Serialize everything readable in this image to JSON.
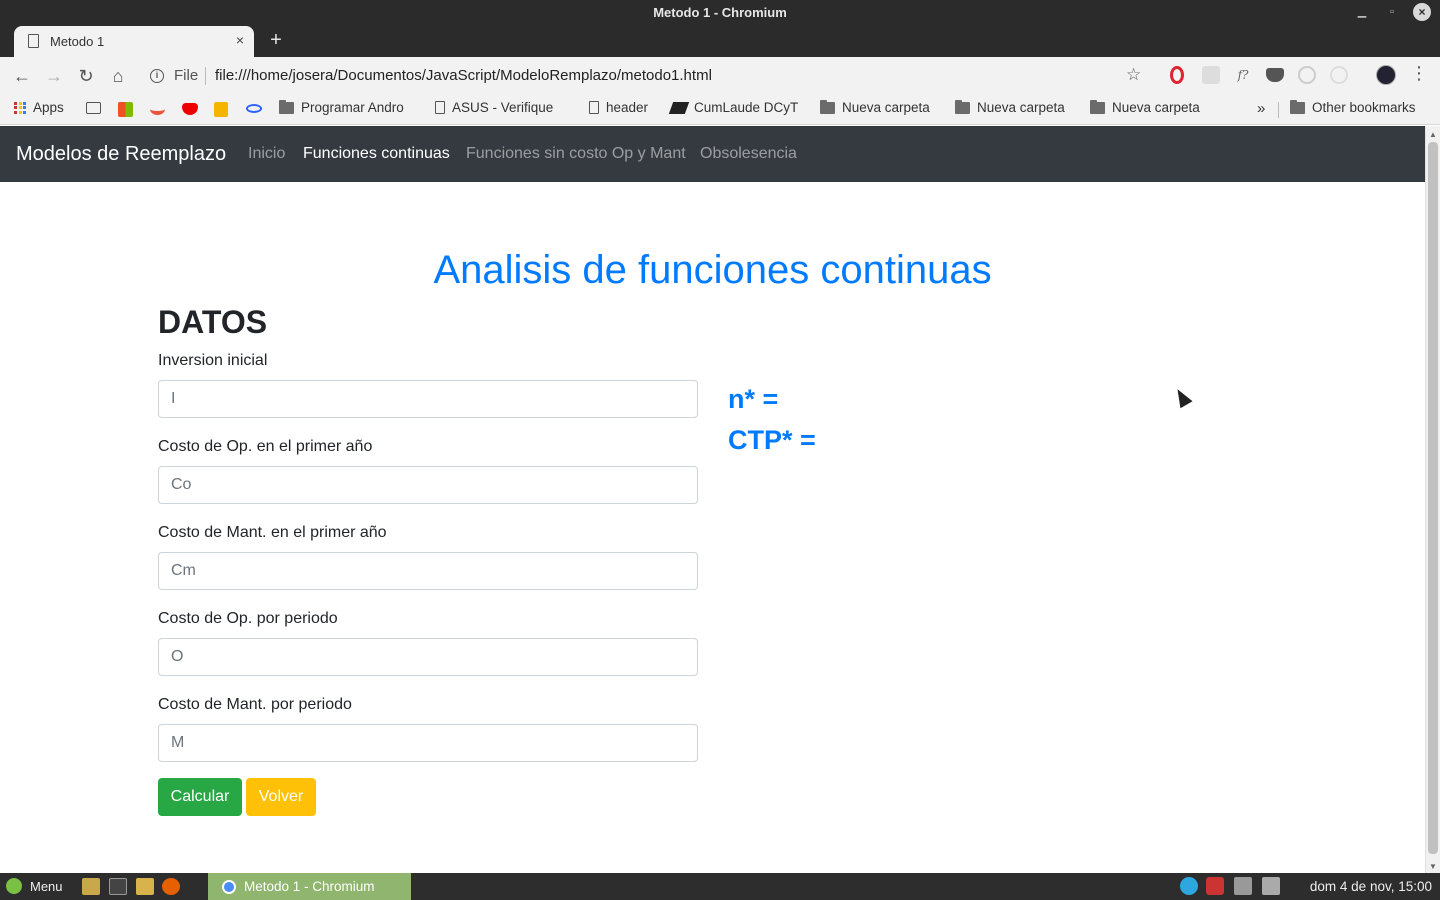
{
  "window": {
    "title": "Metodo 1 - Chromium"
  },
  "tab": {
    "label": "Metodo 1",
    "close": "×"
  },
  "toolbar": {
    "new_tab": "+",
    "back": "←",
    "forward": "→",
    "reload": "↻",
    "home": "⌂",
    "omni_scheme": "File",
    "url": "file:///home/josera/Documentos/JavaScript/ModeloRemplazo/metodo1.html",
    "star": "☆",
    "menu": "⋮"
  },
  "bookmarks": {
    "items": [
      "Apps",
      "Programar Andro",
      "ASUS - Verifique",
      "header",
      "CumLaude DCyT",
      "Nueva carpeta",
      "Nueva carpeta",
      "Nueva carpeta"
    ],
    "more": "»",
    "other": "Other bookmarks"
  },
  "navbar": {
    "brand": "Modelos de Reemplazo",
    "links": [
      "Inicio",
      "Funciones continuas",
      "Funciones sin costo Op y Mant",
      "Obsolesencia"
    ],
    "active_index": 1
  },
  "page": {
    "title": "Analisis de funciones continuas",
    "section": "DATOS",
    "fields": [
      {
        "label": "Inversion inicial",
        "placeholder": "I"
      },
      {
        "label": "Costo de Op. en el primer año",
        "placeholder": "Co"
      },
      {
        "label": "Costo de Mant. en el primer año",
        "placeholder": "Cm"
      },
      {
        "label": "Costo de Op. por periodo",
        "placeholder": "O"
      },
      {
        "label": "Costo de Mant. por periodo",
        "placeholder": "M"
      }
    ],
    "buttons": {
      "calc": "Calcular",
      "back": "Volver"
    },
    "results": {
      "n": "n* =",
      "ctp": "CTP* ="
    }
  },
  "taskbar": {
    "menu": "Menu",
    "task": "Metodo 1 - Chromium",
    "clock": "dom  4 de nov, 15:00"
  },
  "colors": {
    "primary": "#007bff",
    "navbar": "#343a40",
    "success": "#28a745",
    "warning": "#ffc107"
  }
}
